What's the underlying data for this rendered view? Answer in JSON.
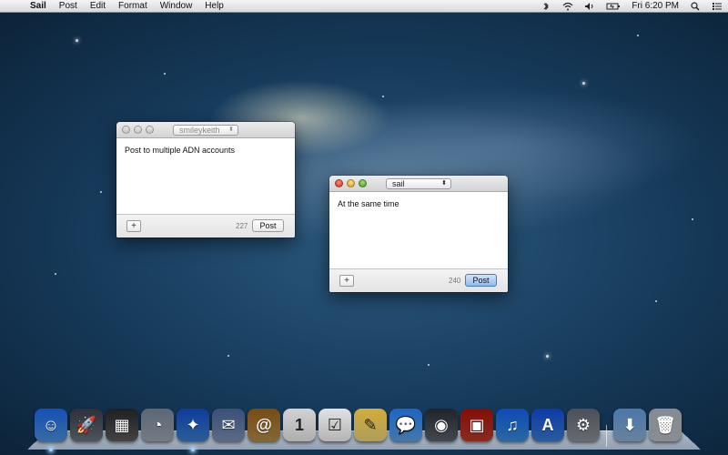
{
  "menubar": {
    "apple_glyph": "",
    "app_name": "Sail",
    "menus": [
      "Post",
      "Edit",
      "Format",
      "Window",
      "Help"
    ],
    "clock": "Fri 6:20 PM",
    "status_icons": [
      "bluetooth-icon",
      "wifi-icon",
      "speaker-icon",
      "battery-icon",
      "spotlight-icon",
      "notification-center-icon"
    ]
  },
  "windows": [
    {
      "account": "smileykeith",
      "text": "Post to multiple ADN accounts",
      "char_count": "227",
      "post_label": "Post",
      "add_label": "+",
      "active": false
    },
    {
      "account": "sail",
      "text": "At the same time",
      "char_count": "240",
      "post_label": "Post",
      "add_label": "+",
      "active": true
    }
  ],
  "dock": {
    "apps": [
      {
        "name": "finder-icon",
        "glyph": "☺",
        "color": "#4a8fd8"
      },
      {
        "name": "launchpad-icon",
        "glyph": "🚀",
        "color": "#6a6f7a"
      },
      {
        "name": "mission-control-icon",
        "glyph": "▦",
        "color": "#5a5a5a"
      },
      {
        "name": "dashboard-icon",
        "glyph": "◔",
        "color": "#9aa3ad"
      },
      {
        "name": "safari-icon",
        "glyph": "✦",
        "color": "#3a7cc8"
      },
      {
        "name": "mail-icon",
        "glyph": "✉",
        "color": "#7a8fb0"
      },
      {
        "name": "contacts-icon",
        "glyph": "@",
        "color": "#b08a4a"
      },
      {
        "name": "calendar-icon",
        "glyph": "1",
        "color": "#e8e8e8"
      },
      {
        "name": "reminders-icon",
        "glyph": "☑",
        "color": "#f0f0f0"
      },
      {
        "name": "notes-icon",
        "glyph": "✎",
        "color": "#e8d27a"
      },
      {
        "name": "messages-icon",
        "glyph": "💬",
        "color": "#5aa0e0"
      },
      {
        "name": "facetime-icon",
        "glyph": "◉",
        "color": "#5a5f68"
      },
      {
        "name": "photo-booth-icon",
        "glyph": "▣",
        "color": "#b83a2a"
      },
      {
        "name": "itunes-icon",
        "glyph": "♫",
        "color": "#3a8ad8"
      },
      {
        "name": "app-store-icon",
        "glyph": "A",
        "color": "#3a7ad0"
      },
      {
        "name": "system-preferences-icon",
        "glyph": "⚙",
        "color": "#8a8f96"
      },
      {
        "name": "downloads-folder-icon",
        "glyph": "⬇",
        "color": "#8aaed0"
      },
      {
        "name": "trash-icon",
        "glyph": "🗑",
        "color": "#b8bcc2"
      }
    ]
  }
}
